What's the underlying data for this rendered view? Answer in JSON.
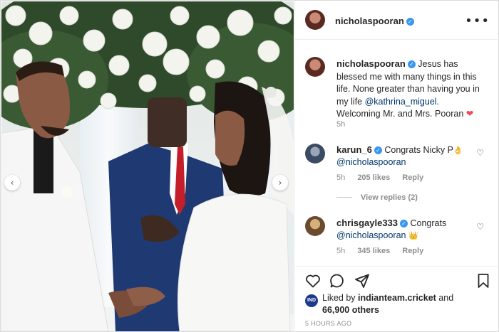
{
  "post": {
    "username": "nicholaspooran",
    "verified_mark": "✓",
    "more_icon": "more-horizontal-icon",
    "caption_prefix": "Jesus has blessed me with many things in this life. None greater than having you in my life",
    "caption_mention": "@kathrina_miguel",
    "caption_dot": ".",
    "caption_suffix": "Welcoming Mr. and Mrs. Pooran",
    "caption_emoji": "❤",
    "caption_time": "5h"
  },
  "comments": [
    {
      "username": "karun_6",
      "text": "Congrats Nicky P",
      "emoji": "👌",
      "mention": "@nicholaspooran",
      "time": "5h",
      "likes": "205 likes",
      "reply": "Reply",
      "view_replies": "View replies (2)"
    },
    {
      "username": "chrisgayle333",
      "text": "Congrats",
      "mention": "@nicholaspooran",
      "emoji": "👑",
      "time": "5h",
      "likes": "345 likes",
      "reply": "Reply"
    }
  ],
  "engagement": {
    "liked_by_prefix": "Liked by",
    "liked_by_user": "indianteam.cricket",
    "liked_by_and": "and",
    "others_count": "66,900 others",
    "posted_ago": "5 HOURS AGO",
    "liked_avatar_text": "IND"
  },
  "carousel": {
    "prev": "‹",
    "next": "›"
  },
  "colors": {
    "verified": "#3897f0",
    "heart": "#ed4956",
    "mention": "#00376b",
    "muted": "#8e8e8e"
  }
}
